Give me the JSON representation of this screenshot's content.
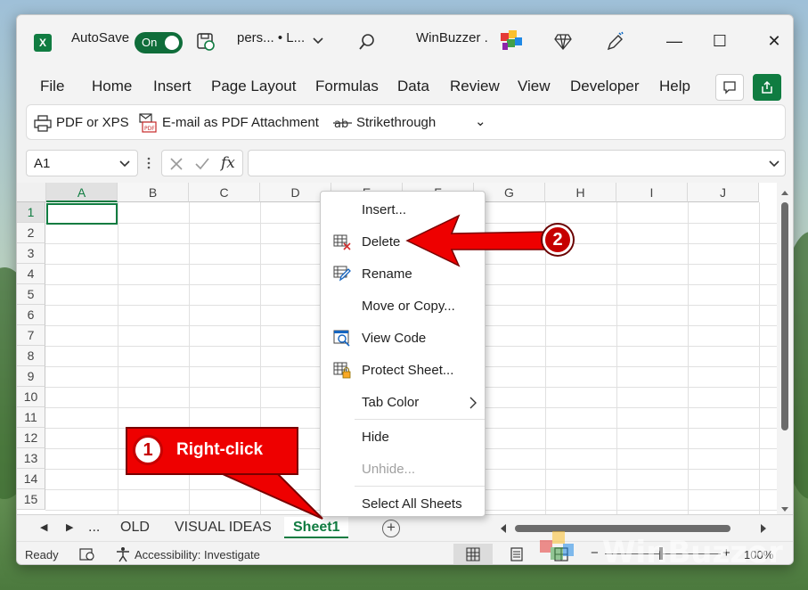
{
  "titlebar": {
    "autosave_label": "AutoSave",
    "toggle_state": "On",
    "filename": "pers...  • L...",
    "account": "WinBuzzer .",
    "minimize": "—",
    "maximize": "☐",
    "close": "✕"
  },
  "menu": {
    "items": [
      "File",
      "Home",
      "Insert",
      "Page Layout",
      "Formulas",
      "Data",
      "Review",
      "View",
      "Developer",
      "Help"
    ]
  },
  "ribbon": {
    "items": [
      "PDF or XPS",
      "E-mail as PDF Attachment",
      "Strikethrough"
    ],
    "more": "⌄"
  },
  "formula": {
    "namebox": "A1",
    "fx": "fx",
    "value": ""
  },
  "grid": {
    "columns": [
      "A",
      "B",
      "C",
      "D",
      "E",
      "F",
      "G",
      "H",
      "I",
      "J"
    ],
    "rows": [
      "1",
      "2",
      "3",
      "4",
      "5",
      "6",
      "7",
      "8",
      "9",
      "10",
      "11",
      "12",
      "13",
      "14",
      "15"
    ],
    "active_cell": "A1"
  },
  "tabs": {
    "nav_prev": "◀",
    "nav_next": "▶",
    "ellipsis": "...",
    "sheets": [
      "OLD",
      "VISUAL IDEAS",
      "Sheet1"
    ],
    "active": "Sheet1",
    "add": "+"
  },
  "status": {
    "ready": "Ready",
    "accessibility": "Accessibility: Investigate",
    "zoom": "100%",
    "zoom_minus": "−",
    "zoom_plus": "+"
  },
  "context_menu": {
    "items": [
      {
        "label": "Insert...",
        "disabled": false
      },
      {
        "label": "Delete",
        "disabled": false
      },
      {
        "label": "Rename",
        "disabled": false
      },
      {
        "label": "Move or Copy...",
        "disabled": false
      },
      {
        "label": "View Code",
        "disabled": false
      },
      {
        "label": "Protect Sheet...",
        "disabled": false
      },
      {
        "label": "Tab Color",
        "disabled": false
      },
      {
        "label": "Hide",
        "disabled": false
      },
      {
        "label": "Unhide...",
        "disabled": true
      },
      {
        "label": "Select All Sheets",
        "disabled": false
      }
    ],
    "submenu_arrow": "›"
  },
  "annotations": {
    "step1_number": "1",
    "step1_text": "Right-click",
    "step2_number": "2"
  },
  "watermark": "WinBuzzer",
  "colors": {
    "excel_green": "#107c41",
    "callout_red": "#e00000"
  }
}
